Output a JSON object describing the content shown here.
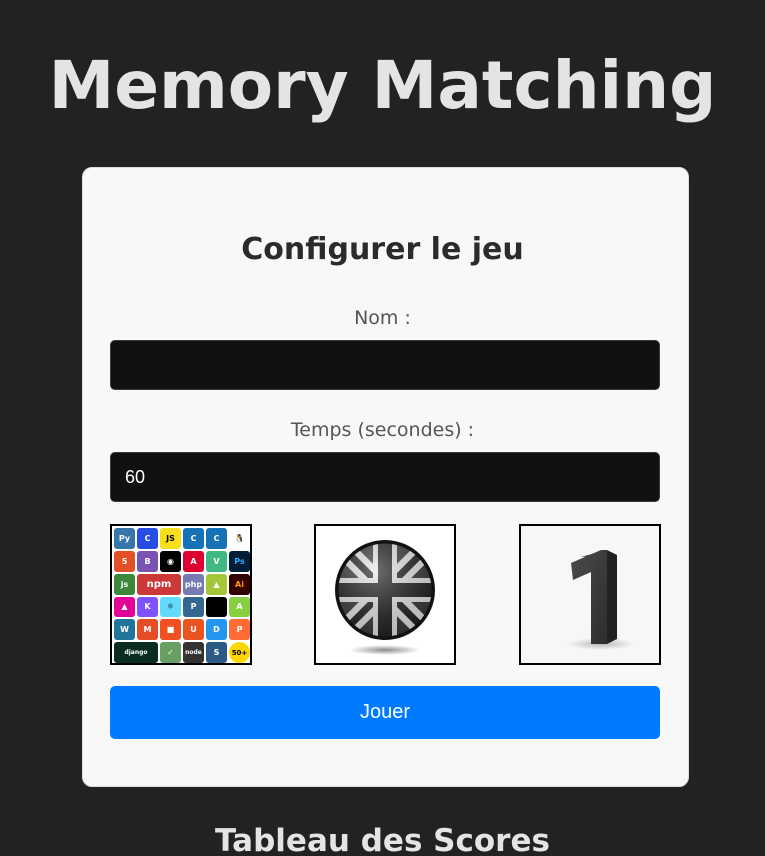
{
  "app": {
    "title": "Memory Matching"
  },
  "config": {
    "heading": "Configurer le jeu",
    "name_label": "Nom :",
    "name_value": "",
    "time_label": "Temps (secondes) :",
    "time_value": "60"
  },
  "themes": [
    {
      "name": "logos",
      "icon": "programming-logos-collage",
      "badge": "50+",
      "text_1": "npm",
      "text_2": "php",
      "text_3": "django",
      "text_4": "node"
    },
    {
      "name": "flags",
      "icon": "union-jack-globe-monochrome"
    },
    {
      "name": "numbers",
      "icon": "digit-one-3d",
      "digit": "1"
    }
  ],
  "actions": {
    "play_label": "Jouer"
  },
  "scores": {
    "title": "Tableau des Scores"
  },
  "colors": {
    "background": "#222222",
    "card": "#f8f8f8",
    "accent": "#007bff",
    "input": "#111111"
  }
}
